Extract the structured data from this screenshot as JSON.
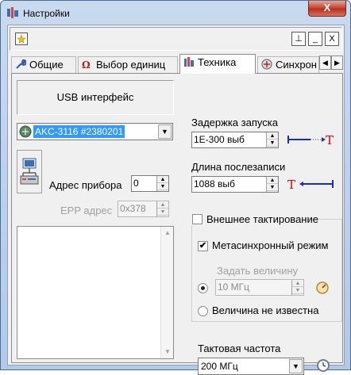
{
  "window": {
    "title": "Настройки",
    "close_label": "X"
  },
  "toolbar": {
    "btn1": "⊥",
    "btn2": "_",
    "btn3": "X"
  },
  "tabs": [
    {
      "label": "Общие"
    },
    {
      "label": "Выбор единиц"
    },
    {
      "label": "Техника"
    },
    {
      "label": "Синхрон"
    }
  ],
  "tab_scroll": {
    "left": "◀",
    "right": "▶"
  },
  "left": {
    "usb_label": "USB интерфейс",
    "device": "AKC-3116 #2380201",
    "address_label": "Адрес прибора",
    "address_value": "0",
    "epp_label": "EPP адрес",
    "epp_value": "0x378"
  },
  "right": {
    "delay_label": "Задержка запуска",
    "delay_value": "1E-300 выб",
    "post_label": "Длина послезаписи",
    "post_value": "1088 выб",
    "trigger_marker": "T",
    "ext_clock_label": "Внешнее тактирование",
    "meta_label": "Метасинхронный режим",
    "meta_checked": "✔",
    "set_value_label": "Задать величину",
    "freq_value": "10 МГц",
    "unknown_label": "Величина не известна",
    "clock_freq_label": "Тактовая частота",
    "clock_freq_value": "200 МГц"
  },
  "colors": {
    "marker_blue": "#1a2cc7",
    "marker_red": "#e00000",
    "selection": "#3399ff"
  }
}
